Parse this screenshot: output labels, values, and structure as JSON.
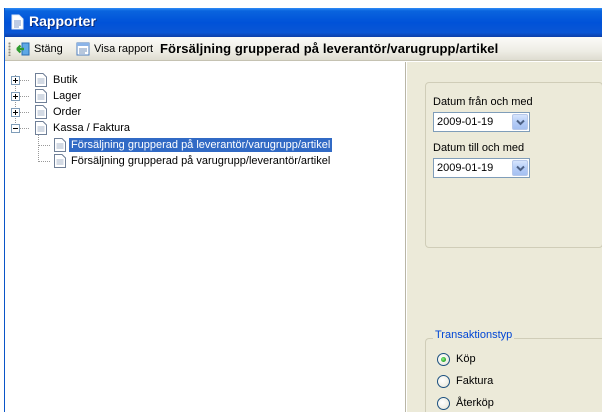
{
  "window": {
    "title": "Rapporter"
  },
  "toolbar": {
    "close_label": "Stäng",
    "show_report_label": "Visa rapport",
    "report_title": "Försäljning grupperad på leverantör/varugrupp/artikel"
  },
  "tree": {
    "nodes": [
      {
        "label": "Butik",
        "expanded": false
      },
      {
        "label": "Lager",
        "expanded": false
      },
      {
        "label": "Order",
        "expanded": false
      },
      {
        "label": "Kassa / Faktura",
        "expanded": true,
        "children": [
          {
            "label": "Försäljning grupperad på leverantör/varugrupp/artikel",
            "selected": true
          },
          {
            "label": "Försäljning grupperad på varugrupp/leverantör/artikel",
            "selected": false
          }
        ]
      }
    ]
  },
  "filters": {
    "date_from_label": "Datum från och med",
    "date_from_value": "2009-01-19",
    "date_to_label": "Datum till och med",
    "date_to_value": "2009-01-19"
  },
  "transaction": {
    "caption": "Transaktionstyp",
    "options": [
      {
        "label": "Köp",
        "checked": true
      },
      {
        "label": "Faktura",
        "checked": false
      },
      {
        "label": "Återköp",
        "checked": false
      }
    ]
  },
  "colors": {
    "titlebar": "#0052d8",
    "selection": "#316ac5",
    "panel": "#ecead9",
    "group_caption": "#0046d5"
  }
}
